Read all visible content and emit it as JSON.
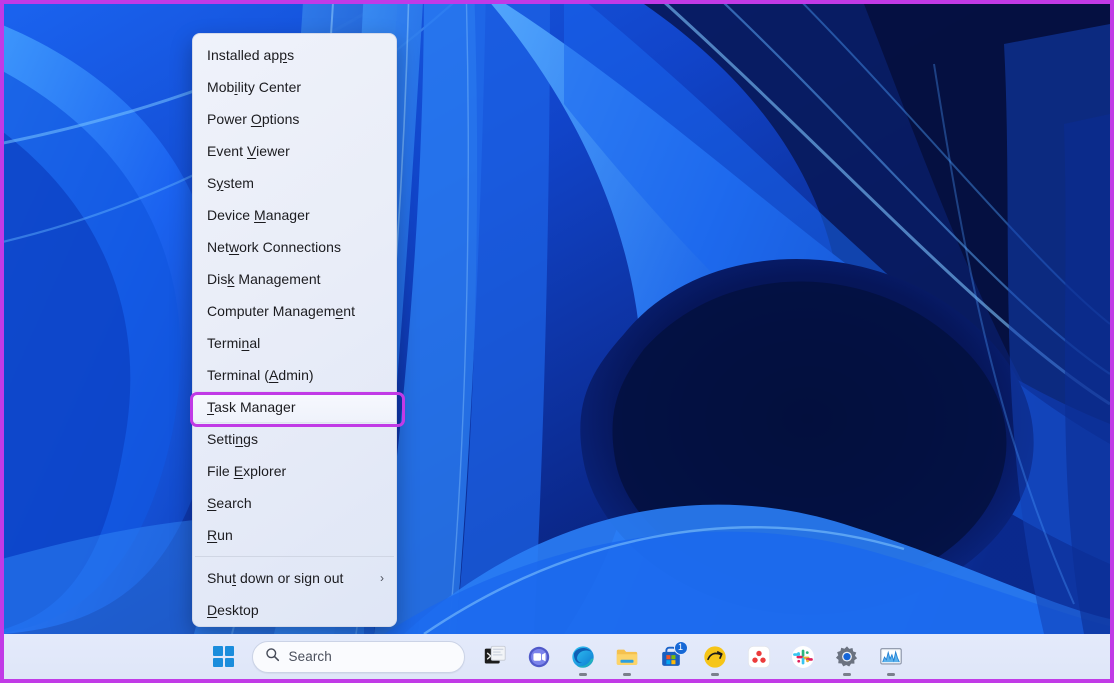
{
  "window": {
    "title": "Windows 11 Desktop",
    "highlight_color": "#c13ae6",
    "taskbar_bg": "#e2e8f8",
    "accent_color": "#1b8ddc"
  },
  "context_menu": {
    "name": "win-x-power-user-menu",
    "items": [
      {
        "label": "Installed apps",
        "access_key": "a",
        "key_index": 12,
        "submenu": false,
        "separator_after": false
      },
      {
        "label": "Mobility Center",
        "access_key": "b",
        "key_index": 3,
        "submenu": false,
        "separator_after": false
      },
      {
        "label": "Power Options",
        "access_key": "O",
        "key_index": 6,
        "submenu": false,
        "separator_after": false
      },
      {
        "label": "Event Viewer",
        "access_key": "V",
        "key_index": 6,
        "submenu": false,
        "separator_after": false
      },
      {
        "label": "System",
        "access_key": "y",
        "key_index": 1,
        "submenu": false,
        "separator_after": false
      },
      {
        "label": "Device Manager",
        "access_key": "M",
        "key_index": 7,
        "submenu": false,
        "separator_after": false
      },
      {
        "label": "Network Connections",
        "access_key": "w",
        "key_index": 3,
        "submenu": false,
        "separator_after": false
      },
      {
        "label": "Disk Management",
        "access_key": "k",
        "key_index": 3,
        "submenu": false,
        "separator_after": false
      },
      {
        "label": "Computer Management",
        "access_key": "g",
        "key_index": 16,
        "submenu": false,
        "separator_after": false
      },
      {
        "label": "Terminal",
        "access_key": "i",
        "key_index": 5,
        "submenu": false,
        "separator_after": false
      },
      {
        "label": "Terminal (Admin)",
        "access_key": "A",
        "key_index": 10,
        "submenu": false,
        "separator_after": false
      },
      {
        "label": "Task Manager",
        "access_key": "T",
        "key_index": 0,
        "submenu": false,
        "separator_after": false,
        "highlighted": true
      },
      {
        "label": "Settings",
        "access_key": "n",
        "key_index": 5,
        "submenu": false,
        "separator_after": false
      },
      {
        "label": "File Explorer",
        "access_key": "E",
        "key_index": 5,
        "submenu": false,
        "separator_after": false
      },
      {
        "label": "Search",
        "access_key": "S",
        "key_index": 0,
        "submenu": false,
        "separator_after": false
      },
      {
        "label": "Run",
        "access_key": "R",
        "key_index": 0,
        "submenu": false,
        "separator_after": true
      },
      {
        "label": "Shut down or sign out",
        "access_key": "u",
        "key_index": 3,
        "submenu": true,
        "separator_after": false,
        "chevron": "›"
      },
      {
        "label": "Desktop",
        "access_key": "D",
        "key_index": 0,
        "submenu": false,
        "separator_after": false
      }
    ]
  },
  "taskbar": {
    "start_button": {
      "name": "start-button",
      "label": "Start"
    },
    "search": {
      "placeholder": "Search",
      "value": "",
      "icon": "search-icon"
    },
    "items": [
      {
        "name": "terminal",
        "icon": "terminal-icon",
        "label": "Terminal",
        "running": false,
        "badge": ""
      },
      {
        "name": "teams",
        "icon": "teams-icon",
        "label": "Microsoft Teams",
        "running": false,
        "badge": ""
      },
      {
        "name": "edge",
        "icon": "edge-icon",
        "label": "Microsoft Edge",
        "running": true,
        "badge": ""
      },
      {
        "name": "file-explorer",
        "icon": "folder-icon",
        "label": "File Explorer",
        "running": true,
        "badge": ""
      },
      {
        "name": "microsoft-store",
        "icon": "store-icon",
        "label": "Microsoft Store",
        "running": false,
        "badge": "1"
      },
      {
        "name": "zoom",
        "icon": "zoom-app-icon",
        "label": "Zoom",
        "running": true,
        "badge": ""
      },
      {
        "name": "dots-app",
        "icon": "three-dots-icon",
        "label": "App",
        "running": false,
        "badge": ""
      },
      {
        "name": "slack",
        "icon": "slack-icon",
        "label": "Slack",
        "running": false,
        "badge": ""
      },
      {
        "name": "settings",
        "icon": "gear-icon",
        "label": "Settings",
        "running": true,
        "badge": ""
      },
      {
        "name": "task-manager",
        "icon": "task-manager-icon",
        "label": "Task Manager",
        "running": true,
        "badge": ""
      }
    ]
  }
}
